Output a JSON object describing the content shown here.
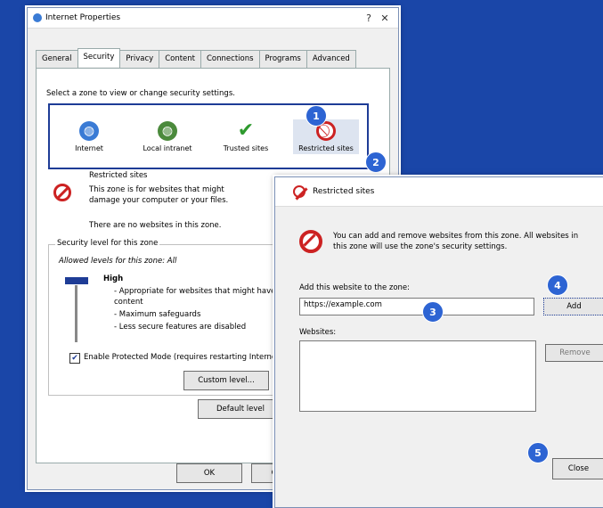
{
  "internet_options": {
    "title": "Internet Properties",
    "tabs": [
      "General",
      "Security",
      "Privacy",
      "Content",
      "Connections",
      "Programs",
      "Advanced"
    ],
    "select_zone_label": "Select a zone to view or change security settings.",
    "zones": [
      {
        "label": "Internet",
        "color": "#3a7bd5"
      },
      {
        "label": "Local intranet",
        "color": "#4b8a3c"
      },
      {
        "label": "Trusted sites",
        "color": "#2e9a2e"
      },
      {
        "label": "Restricted sites",
        "color": "#c22222"
      }
    ],
    "zone_heading": "Restricted sites",
    "zone_desc_line1": "This zone is for websites that might",
    "zone_desc_line2": "damage your computer or your files.",
    "zone_no_sites": "There are no websites in this zone.",
    "security_level_group": "Security level for this zone",
    "allowed_levels": "Allowed levels for this zone: All",
    "level_name": "High",
    "level_bullets": [
      "- Appropriate for websites that might have harmful",
      "  content",
      "- Maximum safeguards",
      "- Less secure features are disabled"
    ],
    "protected_mode_label": "Enable Protected Mode (requires restarting Internet Explorer)",
    "custom_level_button": "Custom level...",
    "default_level_button": "Default level",
    "ok_button": "OK",
    "cancel_button": "Cancel"
  },
  "restricted_dialog": {
    "title": "Restricted sites",
    "info_line1": "You can add and remove websites from this zone. All websites in",
    "info_line2": "this zone will use the zone's security settings.",
    "add_label": "Add this website to the zone:",
    "add_value": "https://example.com",
    "add_button": "Add",
    "websites_label": "Websites:",
    "remove_button": "Remove",
    "close_button": "Close"
  },
  "badges": [
    "1",
    "2",
    "3",
    "4",
    "5"
  ]
}
